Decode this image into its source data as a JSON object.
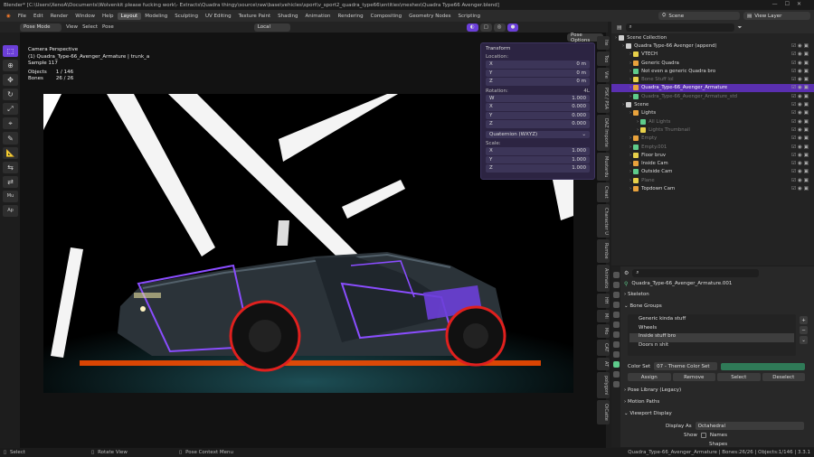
{
  "window": {
    "title": "Blender* [C:\\Users\\XenoA\\Documents\\Wolvenkit please fucking work\\- Extracts\\Quadra thingy\\source\\raw\\base\\vehicles\\sport\\v_sport2_quadra_type66\\entities\\meshes\\Quadra Type66 Avenger.blend]"
  },
  "menu": [
    "File",
    "Edit",
    "Render",
    "Window",
    "Help"
  ],
  "workspaces": [
    "Layout",
    "Modeling",
    "Sculpting",
    "UV Editing",
    "Texture Paint",
    "Shading",
    "Animation",
    "Rendering",
    "Compositing",
    "Geometry Nodes",
    "Scripting"
  ],
  "scene": {
    "name": "Scene",
    "view_layer": "View Layer"
  },
  "viewport_header": {
    "mode": "Pose Mode",
    "menus": [
      "View",
      "Select",
      "Pose"
    ],
    "orientation": "Local",
    "pose_options": "Pose Options"
  },
  "viewport_info": {
    "line1": "Camera Perspective",
    "line2": "(1) Quadra_Type-66_Avenger_Armature | trunk_a",
    "line3": "Sample 117",
    "objects_label": "Objects",
    "objects_value": "1 / 146",
    "bones_label": "Bones",
    "bones_value": "26 / 26"
  },
  "tool_labels": {
    "mu": "Mu",
    "ap": "Ap"
  },
  "transform": {
    "title": "Transform",
    "location_label": "Location:",
    "location": [
      {
        "axis": "X",
        "value": "0 m"
      },
      {
        "axis": "Y",
        "value": "0 m"
      },
      {
        "axis": "Z",
        "value": "0 m"
      }
    ],
    "rotation_label": "Rotation:",
    "rotation_mode_tag": "4L",
    "rotation": [
      {
        "axis": "W",
        "value": "1.000"
      },
      {
        "axis": "X",
        "value": "0.000"
      },
      {
        "axis": "Y",
        "value": "0.000"
      },
      {
        "axis": "Z",
        "value": "0.000"
      }
    ],
    "rotation_mode": "Quaternion (WXYZ)",
    "scale_label": "Scale:",
    "scale": [
      {
        "axis": "X",
        "value": "1.000"
      },
      {
        "axis": "Y",
        "value": "1.000"
      },
      {
        "axis": "Z",
        "value": "1.000"
      }
    ]
  },
  "side_tabs": [
    "Ite",
    "Too",
    "Vie",
    "PSK / PSA",
    "DAZ Importe",
    "Mustardu",
    "Creat",
    "Character U",
    "Rumbe",
    "Animatio",
    "HH",
    "Mi",
    "Mo",
    "CAT",
    "AT",
    "polygoni",
    "OiCatte"
  ],
  "outliner": {
    "rows": [
      {
        "label": "Scene Collection",
        "indent": 0,
        "style": "normal"
      },
      {
        "label": "Quadra Type-66 Avenger (append)",
        "indent": 1,
        "style": "normal"
      },
      {
        "label": "VTECH",
        "indent": 2,
        "style": "normal"
      },
      {
        "label": "Generic Quadra",
        "indent": 2,
        "style": "normal"
      },
      {
        "label": "Not even a generic Quadra bro",
        "indent": 2,
        "style": "normal"
      },
      {
        "label": "Bone Stuff lol",
        "indent": 2,
        "style": "dim"
      },
      {
        "label": "Quadra_Type-66_Avenger_Armature",
        "indent": 2,
        "style": "sel"
      },
      {
        "label": "Quadra_Type-66_Avenger_Armature_std",
        "indent": 2,
        "style": "dim"
      },
      {
        "label": "Scene",
        "indent": 1,
        "style": "normal"
      },
      {
        "label": "Lights",
        "indent": 2,
        "style": "normal"
      },
      {
        "label": "All Lights",
        "indent": 3,
        "style": "dim"
      },
      {
        "label": "Lights Thumbnail",
        "indent": 3,
        "style": "dim"
      },
      {
        "label": "Empty",
        "indent": 2,
        "style": "dim"
      },
      {
        "label": "Empty.001",
        "indent": 2,
        "style": "dim"
      },
      {
        "label": "Floor bruv",
        "indent": 2,
        "style": "normal"
      },
      {
        "label": "Inside Cam",
        "indent": 2,
        "style": "normal"
      },
      {
        "label": "Outside Cam",
        "indent": 2,
        "style": "normal"
      },
      {
        "label": "Plane",
        "indent": 2,
        "style": "dim"
      },
      {
        "label": "Topdown Cam",
        "indent": 2,
        "style": "normal"
      }
    ]
  },
  "properties": {
    "object_name": "Quadra_Type-66_Avenger_Armature.001",
    "skeleton": "Skeleton",
    "bone_groups": "Bone Groups",
    "groups": [
      "Generic kinda stuff",
      "Wheels",
      "Inside stuff bro",
      "Doors n shit"
    ],
    "selected_group": 2,
    "color_set_label": "Color Set",
    "color_set_value": "07 - Theme Color Set",
    "buttons": [
      "Assign",
      "Remove",
      "Select",
      "Deselect"
    ],
    "pose_library": "Pose Library (Legacy)",
    "motion_paths": "Motion Paths",
    "viewport_display": "Viewport Display",
    "display_as_label": "Display As",
    "display_as_value": "Octahedral",
    "show_label": "Show",
    "names": "Names",
    "shapes": "Shapes"
  },
  "status": {
    "select": "Select",
    "rotate": "Rotate View",
    "context": "Pose Context Menu",
    "right": "Quadra_Type-66_Avenger_Armature | Bones:26/26 | Objects:1/146 | 3.3.1"
  },
  "colors": {
    "accent": "#6b3fd8",
    "selection": "#5a2fb0",
    "panel": "#2c2442"
  }
}
